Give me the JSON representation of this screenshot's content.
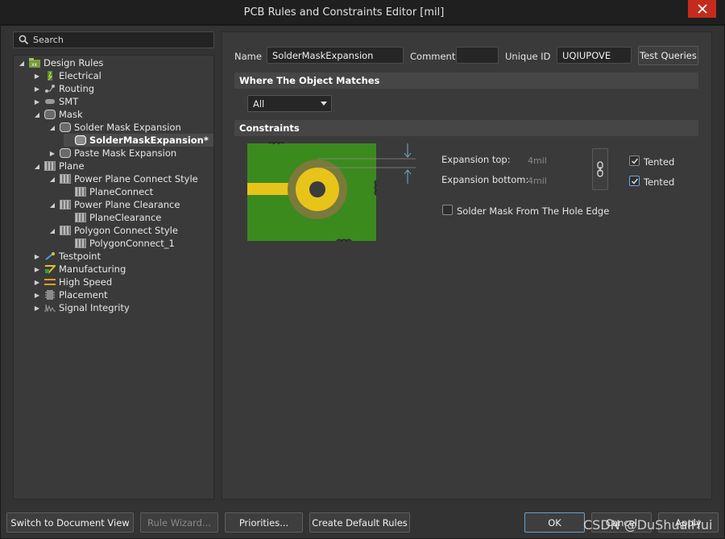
{
  "window": {
    "title": "PCB Rules and Constraints Editor [mil]"
  },
  "search": {
    "placeholder": "Search"
  },
  "tree": {
    "root": "Design Rules",
    "electrical": "Electrical",
    "routing": "Routing",
    "smt": "SMT",
    "mask": "Mask",
    "solder_mask_expansion": "Solder Mask Expansion",
    "solder_mask_rule": "SolderMaskExpansion*",
    "paste_mask_expansion": "Paste Mask Expansion",
    "plane": "Plane",
    "power_plane_connect_style": "Power Plane Connect Style",
    "plane_connect": "PlaneConnect",
    "power_plane_clearance": "Power Plane Clearance",
    "plane_clearance": "PlaneClearance",
    "polygon_connect_style": "Polygon Connect Style",
    "polygon_connect_1": "PolygonConnect_1",
    "testpoint": "Testpoint",
    "manufacturing": "Manufacturing",
    "high_speed": "High Speed",
    "placement": "Placement",
    "signal_integrity": "Signal Integrity"
  },
  "rule": {
    "name_label": "Name",
    "name_value": "SolderMaskExpansion",
    "comment_label": "Comment",
    "comment_value": "",
    "uid_label": "Unique ID",
    "uid_value": "UQIUPOVE",
    "test_queries": "Test Queries"
  },
  "where": {
    "header": "Where The Object Matches",
    "selected": "All"
  },
  "constraints": {
    "header": "Constraints",
    "expansion_top_label": "Expansion top:",
    "expansion_top_value": "4mil",
    "expansion_bottom_label": "Expansion bottom:",
    "expansion_bottom_value": "4mil",
    "tented_top": "Tented",
    "tented_bottom": "Tented",
    "from_hole_edge": "Solder Mask From The Hole Edge",
    "tented_top_checked": true,
    "tented_bottom_checked": true,
    "from_hole_edge_checked": false
  },
  "buttons": {
    "switch_view": "Switch to Document View",
    "rule_wizard": "Rule Wizard...",
    "priorities": "Priorities...",
    "create_default": "Create Default Rules",
    "ok": "OK",
    "cancel": "Cancel",
    "apply": "Apply"
  },
  "watermark": "CSDN @DuShuaiHui",
  "colors": {
    "board_green": "#3b8a1e",
    "mask_ring": "#7a7a3a",
    "pad_yellow": "#e8c41a",
    "hole_gray": "#3c3c3c",
    "close_red": "#c42b1c"
  }
}
